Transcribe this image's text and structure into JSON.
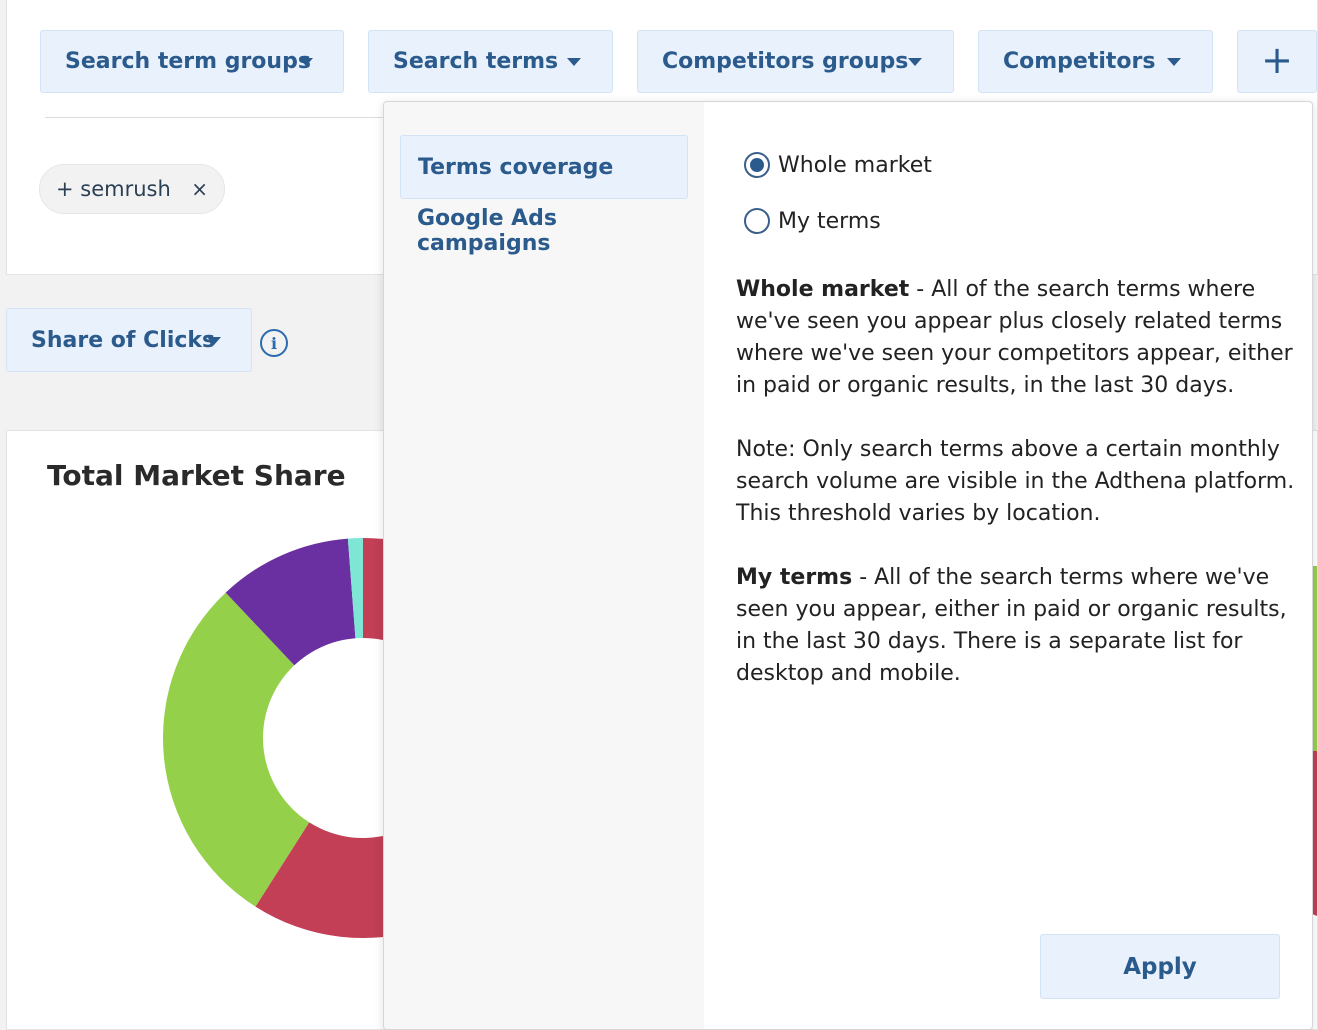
{
  "filters": {
    "search_term_groups": "Search term groups",
    "search_terms": "Search terms",
    "competitors_groups": "Competitors groups",
    "competitors": "Competitors",
    "add": "+"
  },
  "chip": {
    "label": "+ semrush",
    "remove": "×"
  },
  "metric": {
    "label": "Share of Clicks",
    "info": "i"
  },
  "chart": {
    "title": "Total Market Share"
  },
  "chart_data": {
    "type": "pie",
    "title": "Total Market Share",
    "slices": [
      {
        "value": 25.0,
        "color": "#c23f56"
      },
      {
        "value": 24.0,
        "color": "#c23f56"
      },
      {
        "value": 24.0,
        "color": "#94d04a"
      },
      {
        "value": 9.0,
        "color": "#6a2fa0"
      },
      {
        "value": 1.0,
        "color": "#7fe6d6"
      }
    ]
  },
  "dropdown": {
    "menu": {
      "terms_coverage": "Terms coverage",
      "google_ads": "Google Ads campaigns"
    },
    "options": {
      "whole_market": "Whole market",
      "my_terms": "My terms",
      "selected": "whole_market"
    },
    "desc": {
      "wm_title": "Whole market",
      "wm_text": " - All of the search terms where we've seen you appear plus closely related terms where we've seen your competitors appear, either in paid or organic results, in the last 30 days.",
      "note": "Note: Only search terms above a certain monthly search volume are visible in the Adthena platform. This threshold varies by location.",
      "mt_title": "My terms",
      "mt_text": " - All of the search terms where we've seen you appear, either in paid or organic results, in the last 30 days. There is a separate list for desktop and mobile."
    },
    "apply": "Apply"
  },
  "colors": {
    "accent": "#2b5a8c",
    "button_bg": "#e8f1fc",
    "red": "#c23f56",
    "green": "#94d04a",
    "purple": "#6a2fa0",
    "teal": "#7fe6d6"
  }
}
